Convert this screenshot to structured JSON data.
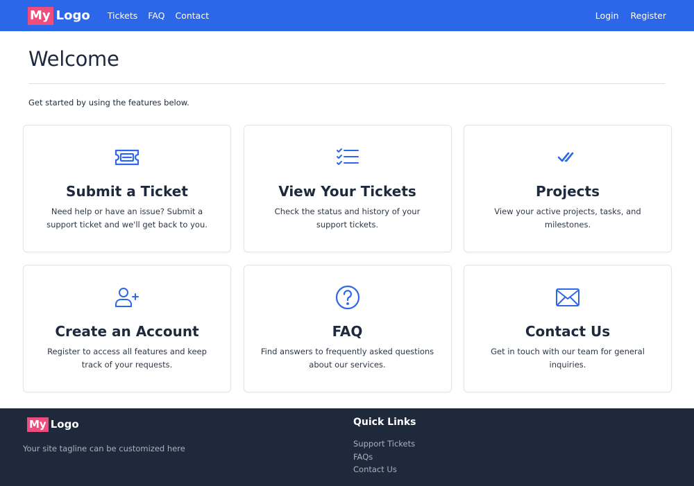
{
  "header": {
    "logo_my": "My",
    "logo_text": "Logo",
    "nav": [
      "Tickets",
      "FAQ",
      "Contact"
    ],
    "login": "Login",
    "register": "Register"
  },
  "main": {
    "title": "Welcome",
    "intro": "Get started by using the features below.",
    "cards": [
      {
        "icon": "ticket-icon",
        "title": "Submit a Ticket",
        "desc": "Need help or have an issue? Submit a support ticket and we'll get back to you."
      },
      {
        "icon": "list-check-icon",
        "title": "View Your Tickets",
        "desc": "Check the status and history of your support tickets."
      },
      {
        "icon": "double-check-icon",
        "title": "Projects",
        "desc": "View your active projects, tasks, and milestones."
      },
      {
        "icon": "user-plus-icon",
        "title": "Create an Account",
        "desc": "Register to access all features and keep track of your requests."
      },
      {
        "icon": "question-circle-icon",
        "title": "FAQ",
        "desc": "Find answers to frequently asked questions about our services."
      },
      {
        "icon": "envelope-icon",
        "title": "Contact Us",
        "desc": "Get in touch with our team for general inquiries."
      }
    ]
  },
  "footer": {
    "logo_my": "My",
    "logo_text": "Logo",
    "tagline": "Your site tagline can be customized here",
    "quick_title": "Quick Links",
    "links": [
      "Support Tickets",
      "FAQs",
      "Contact Us"
    ]
  },
  "colors": {
    "primary": "#2b67e8",
    "logo_accent": "#ee4d7d",
    "footer_bg": "#1e293b"
  }
}
